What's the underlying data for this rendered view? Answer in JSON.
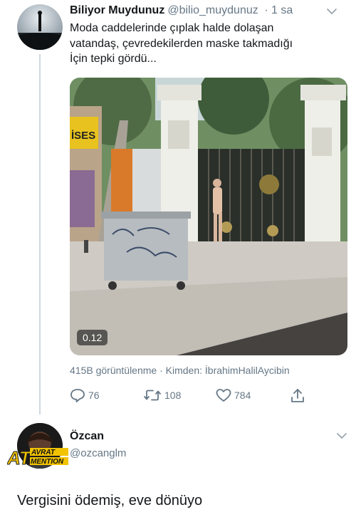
{
  "tweet": {
    "display_name": "Biliyor Muydunuz",
    "handle": "@bilio_muydunuz",
    "time": "· 1 sa",
    "text_lines": [
      "Moda caddelerinde çıplak halde dolaşan",
      "vatandaş, çevredekilerden maske takmadığı",
      "İçin tepki gördü..."
    ],
    "video": {
      "duration": "0.12",
      "sign_text": "İSES"
    },
    "views": "415B görüntülenme · Kimden: İbrahimHalilAycibin",
    "actions": {
      "reply_count": "76",
      "retweet_count": "108",
      "like_count": "784"
    }
  },
  "reply": {
    "display_name": "Özcan",
    "handle": "@ozcanglm",
    "logo_text_top": "AVRAT",
    "logo_text_left": "AT",
    "logo_text_bottom": "MENTION",
    "text": "Vergisini ödemiş, eve dönüyo"
  }
}
